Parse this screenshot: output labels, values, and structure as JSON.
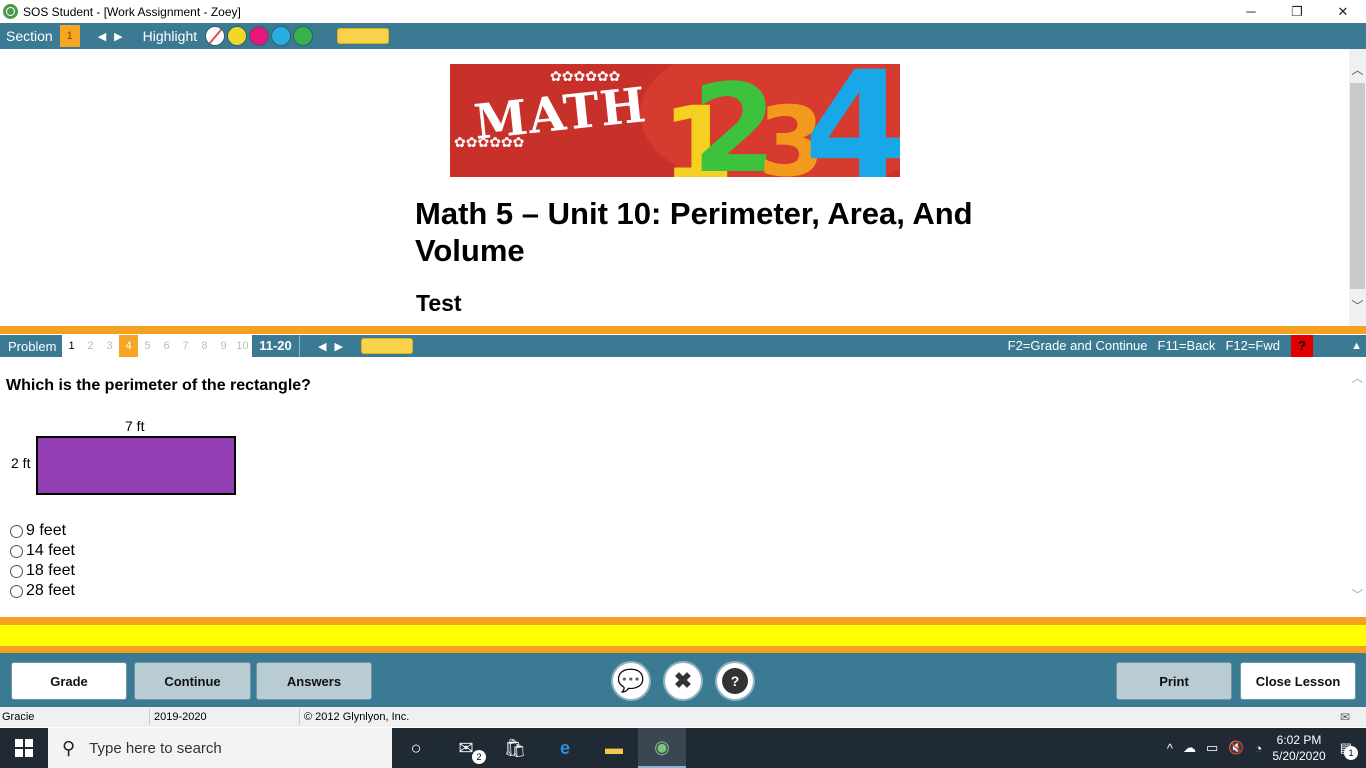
{
  "window": {
    "title": "SOS Student - [Work Assignment - Zoey]",
    "minimize": "─",
    "restore": "❐",
    "close": "✕"
  },
  "section_bar": {
    "section_label": "Section",
    "section_number": "1",
    "prev_arrow": "◀",
    "next_arrow": "▶",
    "highlight_label": "Highlight",
    "highlight_colors": [
      "none",
      "#f0d829",
      "#e8157a",
      "#2aaee0",
      "#37b24d"
    ]
  },
  "lesson": {
    "banner": {
      "word": "MATH",
      "digits": [
        "1",
        "2",
        "3",
        "4"
      ],
      "gears": "✿✿✿✿✿✿"
    },
    "title": "Math 5 – Unit 10: Perimeter, Area, And Volume",
    "subtitle": "Test"
  },
  "problem_bar": {
    "label": "Problem",
    "numbers": [
      "1",
      "2",
      "3",
      "4",
      "5",
      "6",
      "7",
      "8",
      "9",
      "10"
    ],
    "range": "11-20",
    "prev_arrow": "◀",
    "next_arrow": "▶",
    "keys": [
      "F2=Grade and Continue",
      "F11=Back",
      "F12=Fwd"
    ],
    "help": "?",
    "collapse": "▲"
  },
  "question": {
    "text": "Which is the perimeter of the rectangle?",
    "width_label": "7 ft",
    "height_label": "2 ft",
    "rectangle_color": "#933fb3",
    "choices": [
      "9 feet",
      "14 feet",
      "18 feet",
      "28 feet"
    ]
  },
  "actions": {
    "grade": "Grade",
    "continue": "Continue",
    "answers": "Answers",
    "chat_icon": "💬",
    "tools_icon": "✖",
    "help_icon": "?",
    "print": "Print",
    "close_lesson": "Close Lesson"
  },
  "status": {
    "user": "Gracie",
    "year": "2019-2020",
    "copyright": "© 2012 Glynlyon, Inc.",
    "mail_icon": "✉"
  },
  "taskbar": {
    "search_placeholder": "Type here to search",
    "mail_badge": "2",
    "time": "6:02 PM",
    "date": "5/20/2020",
    "notification_count": "1",
    "tray_chevron": "^",
    "icons": [
      "cortana-icon",
      "mail-icon",
      "store-icon",
      "edge-icon",
      "file-explorer-icon",
      "sos-icon"
    ]
  }
}
